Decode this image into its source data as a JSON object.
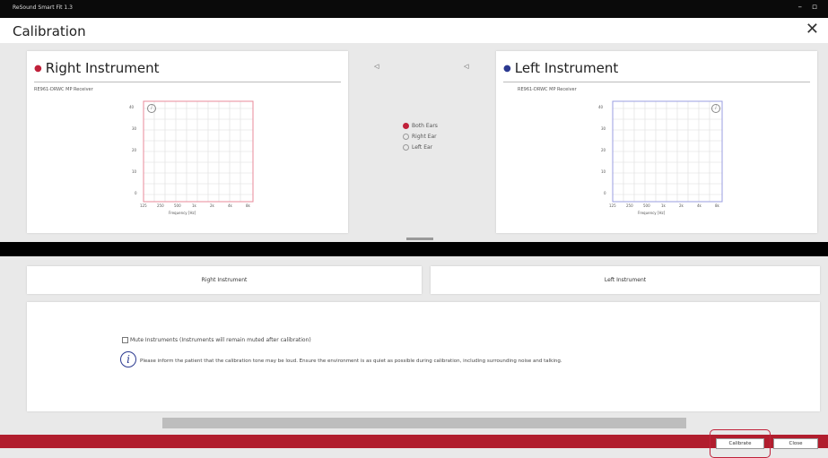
{
  "titlebar": {
    "app": "ReSound Smart Fit 1.3"
  },
  "header": {
    "title": "Calibration",
    "close_glyph": "✕"
  },
  "colors": {
    "right": "#c0213a",
    "left": "#2b3990",
    "footer": "#b11e2e"
  },
  "right_panel": {
    "title": "Right Instrument",
    "receiver": "RE961-DRWC  MP Receiver"
  },
  "left_panel": {
    "title": "Left Instrument",
    "receiver": "RE961-DRWC  MP Receiver"
  },
  "plot": {
    "y_ticks": [
      "40",
      "30",
      "20",
      "10",
      "0"
    ],
    "x_ticks": [
      "125",
      "250",
      "500",
      "1k",
      "2k",
      "4k",
      "8k"
    ],
    "x_label": "Frequency [Hz]"
  },
  "ear_select": {
    "options": [
      {
        "label": "Both Ears",
        "selected": true
      },
      {
        "label": "Right Ear",
        "selected": false
      },
      {
        "label": "Left Ear",
        "selected": false
      }
    ]
  },
  "tabs": {
    "right": "Right Instrument",
    "left": "Left Instrument"
  },
  "options": {
    "mute_label": "Mute Instruments (Instruments will remain muted after calibration)",
    "info_text": "Please inform the patient that the calibration tone may be loud.  Ensure the environment is as quiet as possible during calibration, including surrounding noise and talking."
  },
  "footer": {
    "calibrate": "Calibrate",
    "close": "Close"
  }
}
